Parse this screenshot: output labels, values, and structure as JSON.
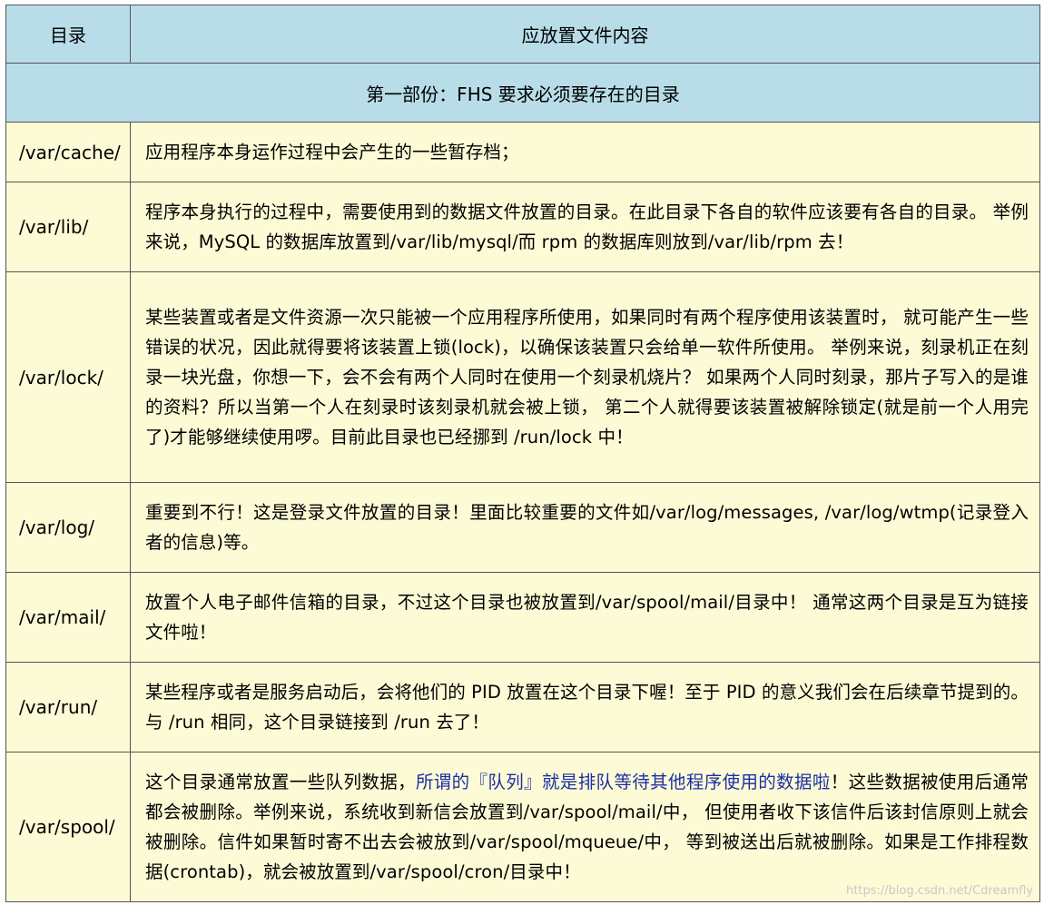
{
  "header": {
    "col_dir": "目录",
    "col_content": "应放置文件内容"
  },
  "section_title": "第一部份：FHS 要求必须要存在的目录",
  "rows": [
    {
      "dir": "/var/cache/",
      "desc": "应用程序本身运作过程中会产生的一些暂存档；"
    },
    {
      "dir": "/var/lib/",
      "desc": "程序本身执行的过程中，需要使用到的数据文件放置的目录。在此目录下各自的软件应该要有各自的目录。 举例来说，MySQL 的数据库放置到/var/lib/mysql/而 rpm 的数据库则放到/var/lib/rpm 去！"
    },
    {
      "dir": "/var/lock/",
      "desc": "某些装置或者是文件资源一次只能被一个应用程序所使用，如果同时有两个程序使用该装置时， 就可能产生一些错误的状况，因此就得要将该装置上锁(lock)，以确保该装置只会给单一软件所使用。 举例来说，刻录机正在刻录一块光盘，你想一下，会不会有两个人同时在使用一个刻录机烧片？ 如果两个人同时刻录，那片子写入的是谁的资料？所以当第一个人在刻录时该刻录机就会被上锁， 第二个人就得要该装置被解除锁定(就是前一个人用完了)才能够继续使用啰。目前此目录也已经挪到 /run/lock 中！"
    },
    {
      "dir": "/var/log/",
      "desc": "重要到不行！这是登录文件放置的目录！里面比较重要的文件如/var/log/messages, /var/log/wtmp(记录登入者的信息)等。"
    },
    {
      "dir": "/var/mail/",
      "desc": "放置个人电子邮件信箱的目录，不过这个目录也被放置到/var/spool/mail/目录中！ 通常这两个目录是互为链接文件啦！"
    },
    {
      "dir": "/var/run/",
      "desc": "某些程序或者是服务启动后，会将他们的 PID 放置在这个目录下喔！至于 PID 的意义我们会在后续章节提到的。 与 /run 相同，这个目录链接到 /run 去了！"
    }
  ],
  "spool_row": {
    "dir": "/var/spool/",
    "desc_before": "这个目录通常放置一些队列数据，",
    "desc_highlight": "所谓的『队列』就是排队等待其他程序使用的数据啦",
    "desc_after": "！这些数据被使用后通常都会被删除。举例来说，系统收到新信会放置到/var/spool/mail/中， 但使用者收下该信件后该封信原则上就会被删除。信件如果暂时寄不出去会被放到/var/spool/mqueue/中， 等到被送出后就被删除。如果是工作排程数据(crontab)，就会被放置到/var/spool/cron/目录中！"
  },
  "watermark": "https://blog.csdn.net/Cdreamfly",
  "colors": {
    "header_bg": "#b8dde9",
    "row_bg": "#fdfbd6",
    "highlight": "#1c2fa6",
    "border": "#555555"
  }
}
